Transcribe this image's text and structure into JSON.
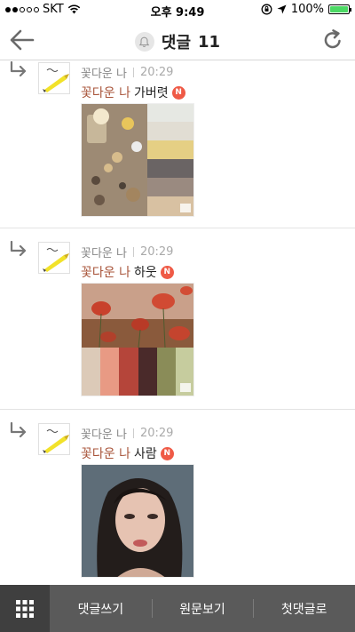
{
  "status_bar": {
    "carrier": "SKT",
    "time": "오후 9:49",
    "battery_percent": "100%"
  },
  "nav": {
    "title": "댓글",
    "count": "11"
  },
  "comments": [
    {
      "author": "꽃다운 나",
      "time": "20:29",
      "mention": "꽃다운 나",
      "text": "가버렷",
      "badge": "N"
    },
    {
      "author": "꽃다운 나",
      "time": "20:29",
      "mention": "꽃다운 나",
      "text": "하웃",
      "badge": "N"
    },
    {
      "author": "꽃다운 나",
      "time": "20:29",
      "mention": "꽃다운 나",
      "text": "사람",
      "badge": "N"
    }
  ],
  "toolbar": {
    "write_comment": "댓글쓰기",
    "view_original": "원문보기",
    "first_comment": "첫댓글로"
  },
  "colors": {
    "mention": "#a8543a",
    "badge": "#ef5a46",
    "toolbar_bg": "#5a5a5a",
    "battery": "#4cd964"
  }
}
